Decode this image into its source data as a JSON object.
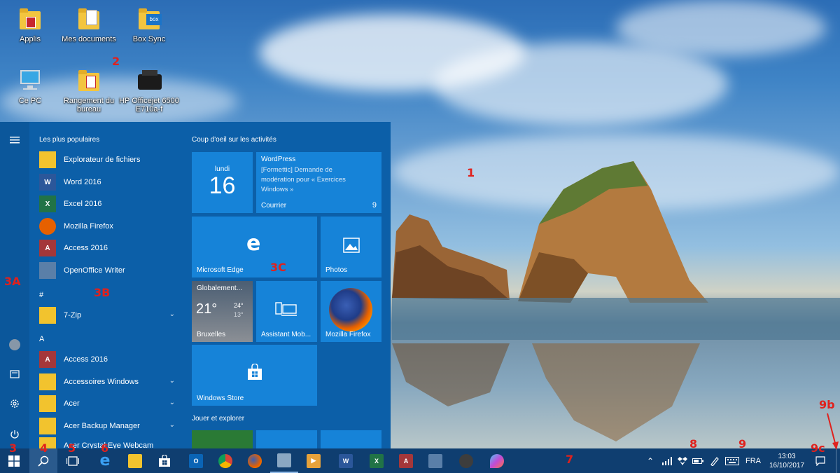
{
  "desktop": {
    "icons": [
      {
        "label": "Applis"
      },
      {
        "label": "Mes documents"
      },
      {
        "label": "Box Sync",
        "badge": "box"
      },
      {
        "label": "Ce PC"
      },
      {
        "label": "Rangement du bureau"
      },
      {
        "label": "HP Officejet 6500 E710a-f"
      }
    ]
  },
  "annotations": [
    "1",
    "2",
    "3A",
    "3B",
    "3C",
    "3",
    "4",
    "5",
    "6",
    "7",
    "8",
    "9",
    "9b",
    "9c"
  ],
  "start_menu": {
    "most_used_header": "Les plus populaires",
    "most_used": [
      {
        "label": "Explorateur de fichiers",
        "icon": "file-explorer-icon",
        "color": "#f2c32e",
        "glyph": ""
      },
      {
        "label": "Word 2016",
        "icon": "word-icon",
        "color": "#2b579a",
        "glyph": "W"
      },
      {
        "label": "Excel 2016",
        "icon": "excel-icon",
        "color": "#217346",
        "glyph": "X"
      },
      {
        "label": "Mozilla Firefox",
        "icon": "firefox-icon",
        "color": "#e66000",
        "glyph": ""
      },
      {
        "label": "Access 2016",
        "icon": "access-icon",
        "color": "#a4373a",
        "glyph": "A"
      },
      {
        "label": "OpenOffice Writer",
        "icon": "openoffice-writer-icon",
        "color": "#5a7fa8",
        "glyph": ""
      }
    ],
    "groups": [
      {
        "letter": "#",
        "items": [
          {
            "label": "7-Zip",
            "folder": true
          }
        ]
      },
      {
        "letter": "A",
        "items": [
          {
            "label": "Access 2016",
            "folder": false
          },
          {
            "label": "Accessoires Windows",
            "folder": true
          },
          {
            "label": "Acer",
            "folder": true
          },
          {
            "label": "Acer Backup Manager",
            "folder": true
          },
          {
            "label": "Acer Crystal Eye Webcam",
            "folder": true
          }
        ]
      }
    ],
    "tiles_header": "Coup d'oeil sur les activités",
    "play_header": "Jouer et explorer",
    "calendar": {
      "day": "lundi",
      "date": "16"
    },
    "mail": {
      "title": "WordPress",
      "body": "[Formettic] Demande de modération pour « Exercices Windows »",
      "app": "Courrier",
      "count": "9"
    },
    "edge_label": "Microsoft Edge",
    "photos_label": "Photos",
    "weather": {
      "title": "Globalement...",
      "temp": "21°",
      "high": "24°",
      "low": "13°",
      "city": "Bruxelles"
    },
    "phone_label": "Assistant Mob...",
    "firefox_label": "Mozilla Firefox",
    "store_label": "Windows Store",
    "user_icon": "user-icon"
  },
  "taskbar": {
    "apps": [
      {
        "name": "mail-icon",
        "color": "#0a64b5",
        "glyph": "O"
      },
      {
        "name": "chrome-icon",
        "color": "#e0a31c",
        "glyph": ""
      },
      {
        "name": "firefox-icon",
        "color": "#e66000",
        "glyph": ""
      },
      {
        "name": "paint-icon",
        "color": "#8aa7c2",
        "glyph": ""
      },
      {
        "name": "media-player-icon",
        "color": "#e7a23a",
        "glyph": "▶"
      },
      {
        "name": "word-icon",
        "color": "#2b579a",
        "glyph": "W"
      },
      {
        "name": "excel-icon",
        "color": "#217346",
        "glyph": "X"
      },
      {
        "name": "access-icon",
        "color": "#a4373a",
        "glyph": "A"
      },
      {
        "name": "openoffice-icon",
        "color": "#5a7fa8",
        "glyph": ""
      },
      {
        "name": "webcam-icon",
        "color": "#3d3d3d",
        "glyph": ""
      },
      {
        "name": "paint3d-icon",
        "color": "#c14bd6",
        "glyph": ""
      }
    ],
    "language": "FRA",
    "time": "13:03",
    "date": "16/10/2017"
  }
}
